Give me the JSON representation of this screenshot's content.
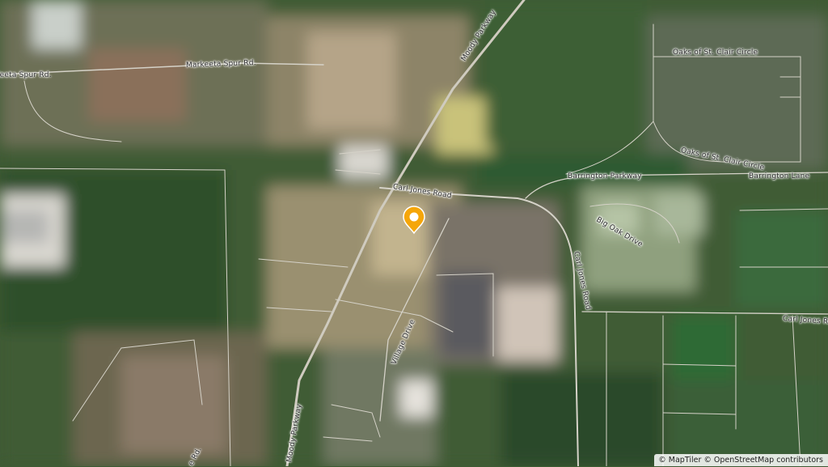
{
  "map": {
    "style": "satellite-hybrid",
    "attribution": {
      "maptiler": "© MapTiler",
      "osm": "© OpenStreetMap contributors"
    },
    "marker": {
      "icon": "location-pin-icon",
      "color": "#f5a60a"
    },
    "road_labels": {
      "keeta_spur": "Keeta Spur Rd.",
      "markeeta_spur": "Markeeta Spur Rd.",
      "moody_parkway_north": "Moody Parkway",
      "moody_parkway_south": "Moody Parkway",
      "carl_jones_road": "Carl Jones Road",
      "carl_jones_road_vertical": "Carl Jones Road",
      "carl_jones_road_east": "Carl Jones Road",
      "village_drive": "Village Drive",
      "barrington_parkway": "Barrington Parkway",
      "barrington_lane": "Barrington Lane",
      "big_oak_drive": "Big Oak Drive",
      "oaks_circle_top": "Oaks of St. Clair Circle",
      "oaks_circle_mid": "Oaks of St. Clair Circle",
      "partial_bottom": "e Rd."
    }
  }
}
